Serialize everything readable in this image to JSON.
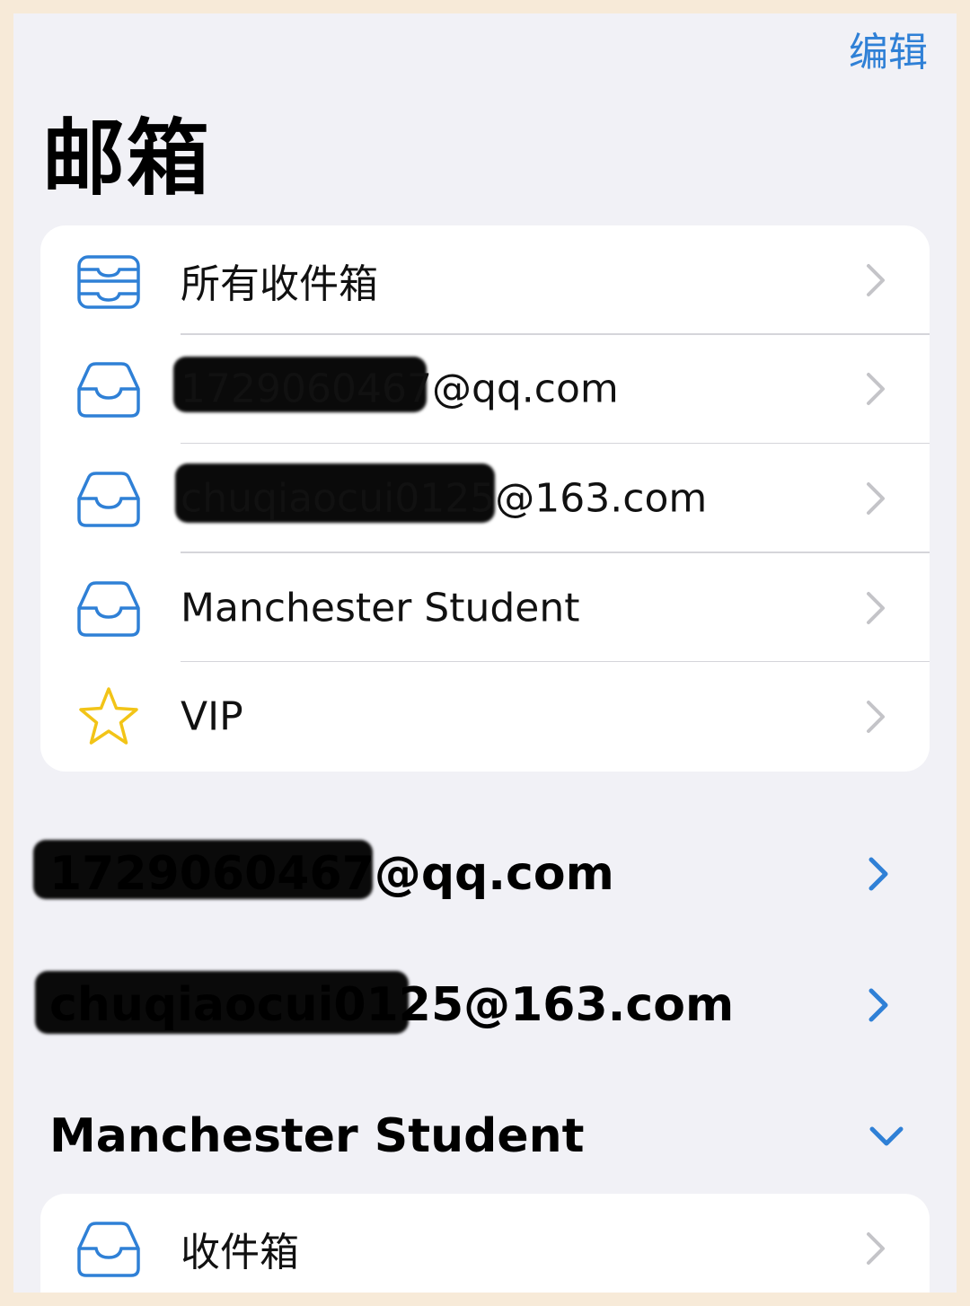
{
  "header": {
    "edit_label": "编辑",
    "title": "邮箱"
  },
  "mailboxes": {
    "items": [
      {
        "label": "所有收件箱",
        "icon": "all-inboxes-icon"
      },
      {
        "label": "1729060467@qq.com",
        "icon": "inbox-icon",
        "redacted": true
      },
      {
        "label": "chuqiaocui0125@163.com",
        "icon": "inbox-icon",
        "redacted": true
      },
      {
        "label": "Manchester Student",
        "icon": "inbox-icon"
      },
      {
        "label": "VIP",
        "icon": "star-icon"
      }
    ]
  },
  "accounts": [
    {
      "label": "1729060467@qq.com",
      "state": "collapsed"
    },
    {
      "label": "chuqiaocui0125@163.com",
      "state": "collapsed"
    },
    {
      "label": "Manchester Student",
      "state": "expanded"
    }
  ],
  "manchester": {
    "items": [
      {
        "label": "收件箱",
        "icon": "inbox-icon"
      }
    ]
  },
  "colors": {
    "accent": "#2f80d6",
    "star": "#f2c417",
    "background": "#f1f1f6",
    "frame": "#f7ead8"
  }
}
